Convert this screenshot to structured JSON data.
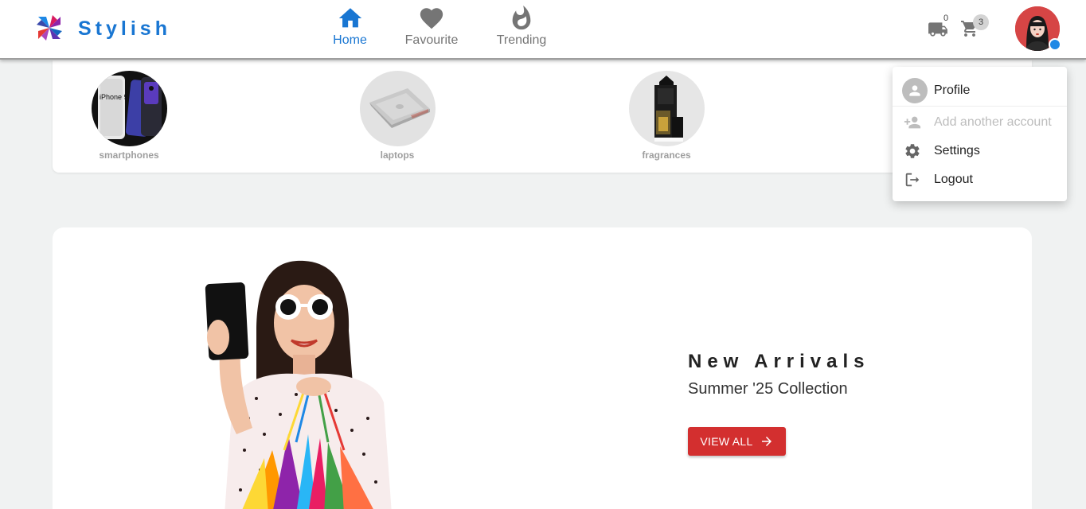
{
  "brand": {
    "name": "Stylish"
  },
  "nav": [
    {
      "label": "Home",
      "icon": "home-icon",
      "active": true
    },
    {
      "label": "Favourite",
      "icon": "heart-icon",
      "active": false
    },
    {
      "label": "Trending",
      "icon": "flame-icon",
      "active": false
    }
  ],
  "header_actions": {
    "orders_count": "0",
    "cart_count": "3"
  },
  "categories": [
    {
      "label": "smartphones",
      "image_text": "iPhone 9"
    },
    {
      "label": "laptops"
    },
    {
      "label": "fragrances"
    }
  ],
  "hero": {
    "title": "New Arrivals",
    "subtitle": "Summer '25 Collection",
    "button_label": "VIEW ALL"
  },
  "account_menu": {
    "profile": "Profile",
    "add_account": "Add another account",
    "settings": "Settings",
    "logout": "Logout"
  },
  "colors": {
    "brand": "#1976d2",
    "accent": "#d32f2f",
    "background": "#f0f2f2"
  }
}
